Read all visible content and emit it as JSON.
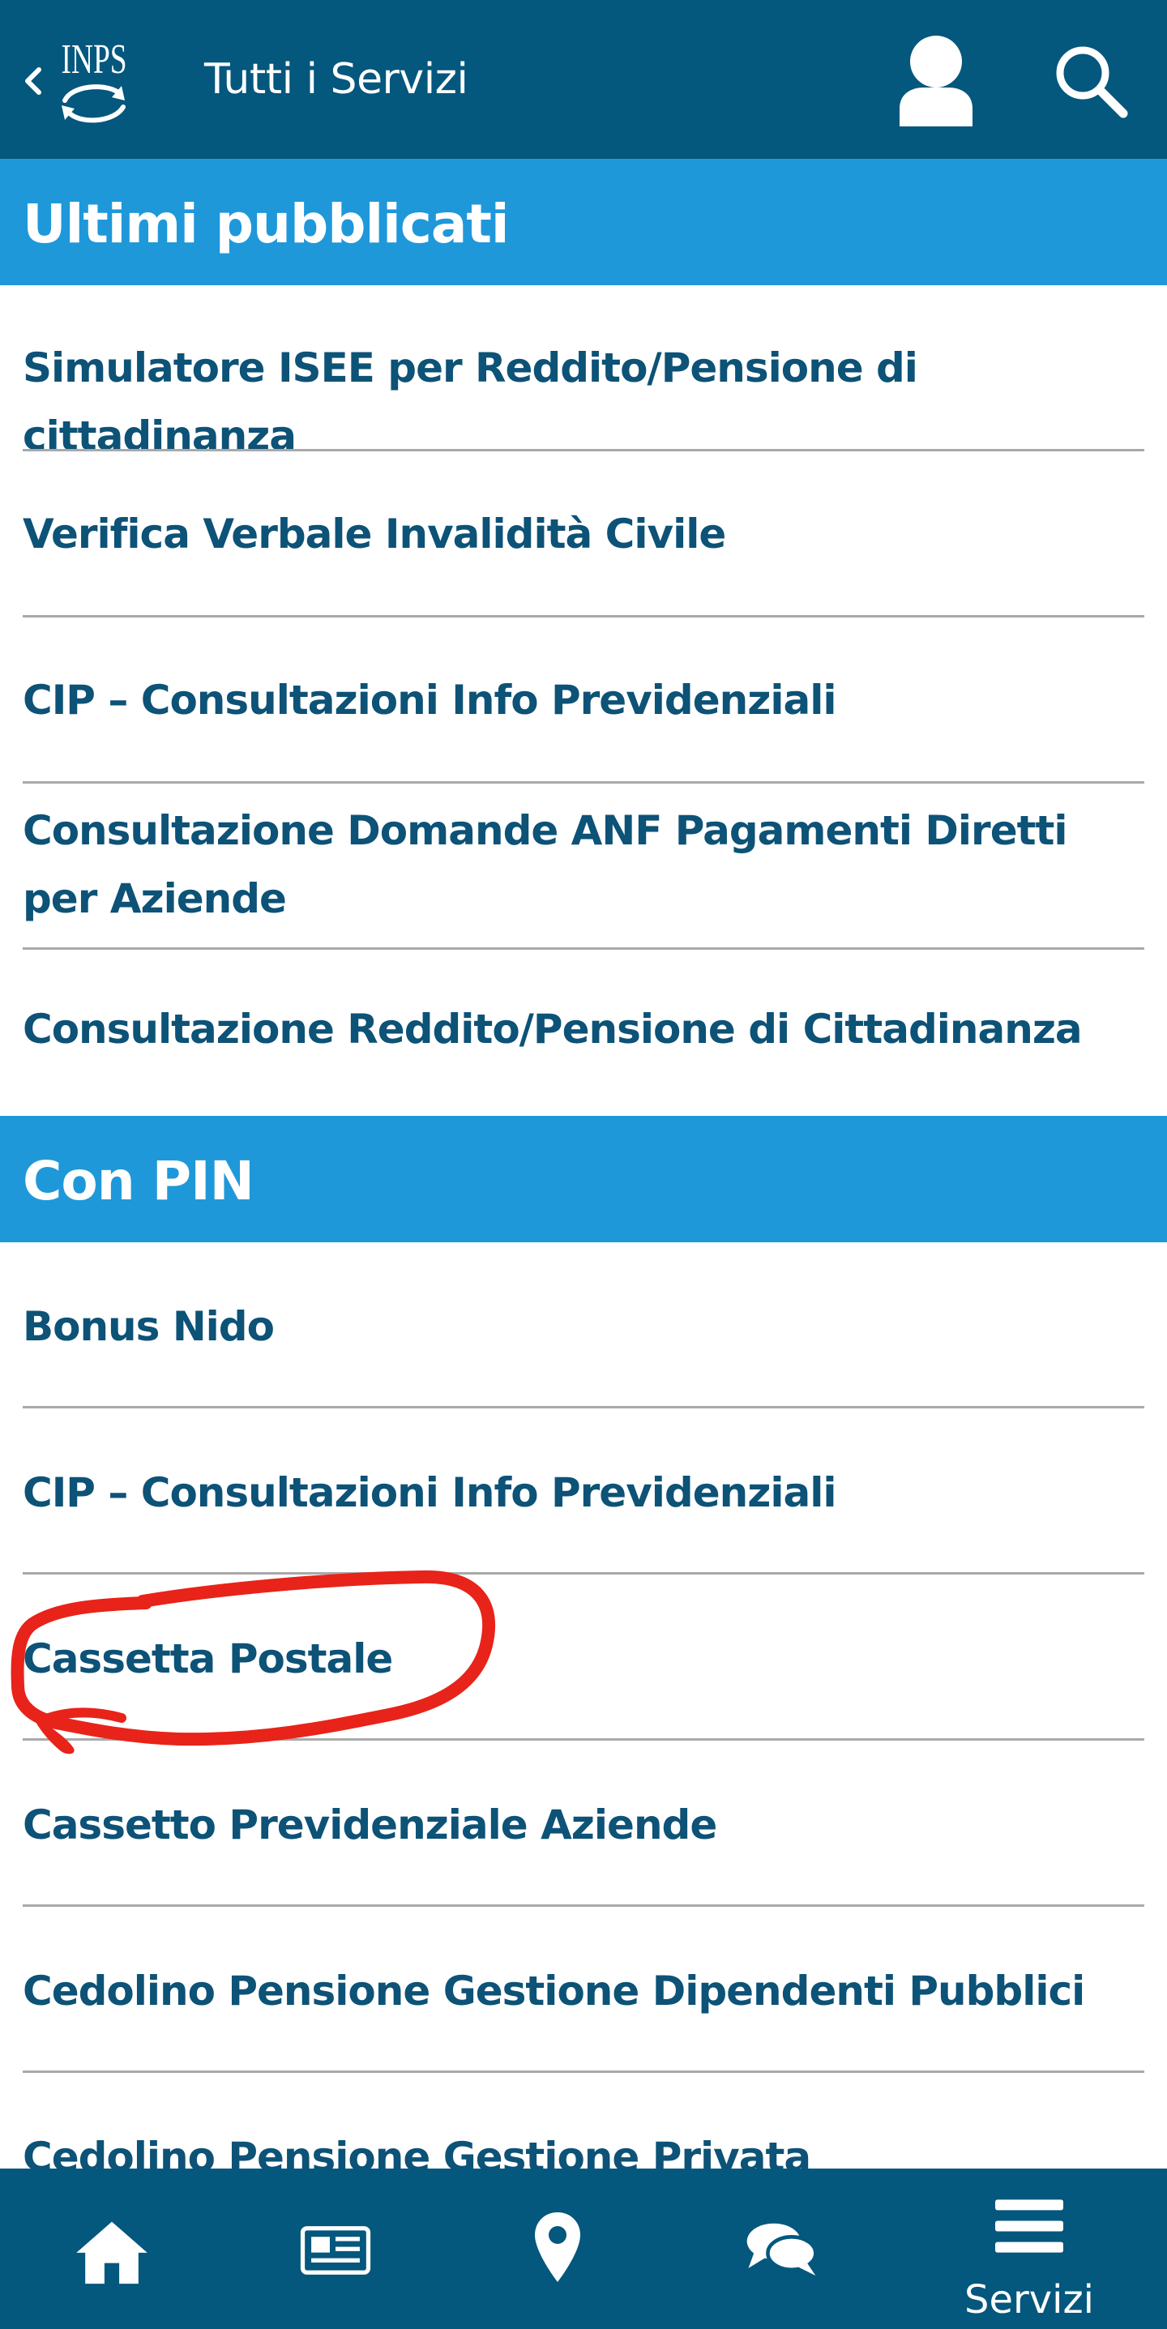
{
  "header": {
    "title": "Tutti i Servizi",
    "logo_text": "INPS",
    "back_icon": "chevron-left-icon",
    "user_icon": "user-icon",
    "search_icon": "search-icon"
  },
  "sections": [
    {
      "title": "Ultimi pubblicati",
      "items": [
        "Simulatore ISEE per Reddito/Pensione di cittadinanza",
        "Verifica Verbale Invalidità Civile",
        "CIP – Consultazioni Info Previdenziali",
        "Consultazione Domande ANF Pagamenti Diretti per Aziende",
        "Consultazione Reddito/Pensione di Cittadinanza"
      ]
    },
    {
      "title": "Con PIN",
      "items": [
        "Bonus Nido",
        "CIP – Consultazioni Info Previdenziali",
        "Cassetta Postale",
        "Cassetto Previdenziale Aziende",
        "Cedolino Pensione Gestione Dipendenti Pubblici",
        "Cedolino Pensione Gestione Privata"
      ]
    }
  ],
  "annotation": {
    "highlighted_item": "Cassetta Postale",
    "color": "#e8231a"
  },
  "bottom_nav": [
    {
      "icon": "home-icon",
      "label": ""
    },
    {
      "icon": "news-icon",
      "label": ""
    },
    {
      "icon": "location-pin-icon",
      "label": ""
    },
    {
      "icon": "chat-icon",
      "label": ""
    },
    {
      "icon": "menu-icon",
      "label": "Servizi"
    }
  ],
  "colors": {
    "header_bg": "#04577d",
    "section_bg": "#1f98da",
    "item_text": "#0d5277",
    "divider": "#a9a9a9"
  }
}
